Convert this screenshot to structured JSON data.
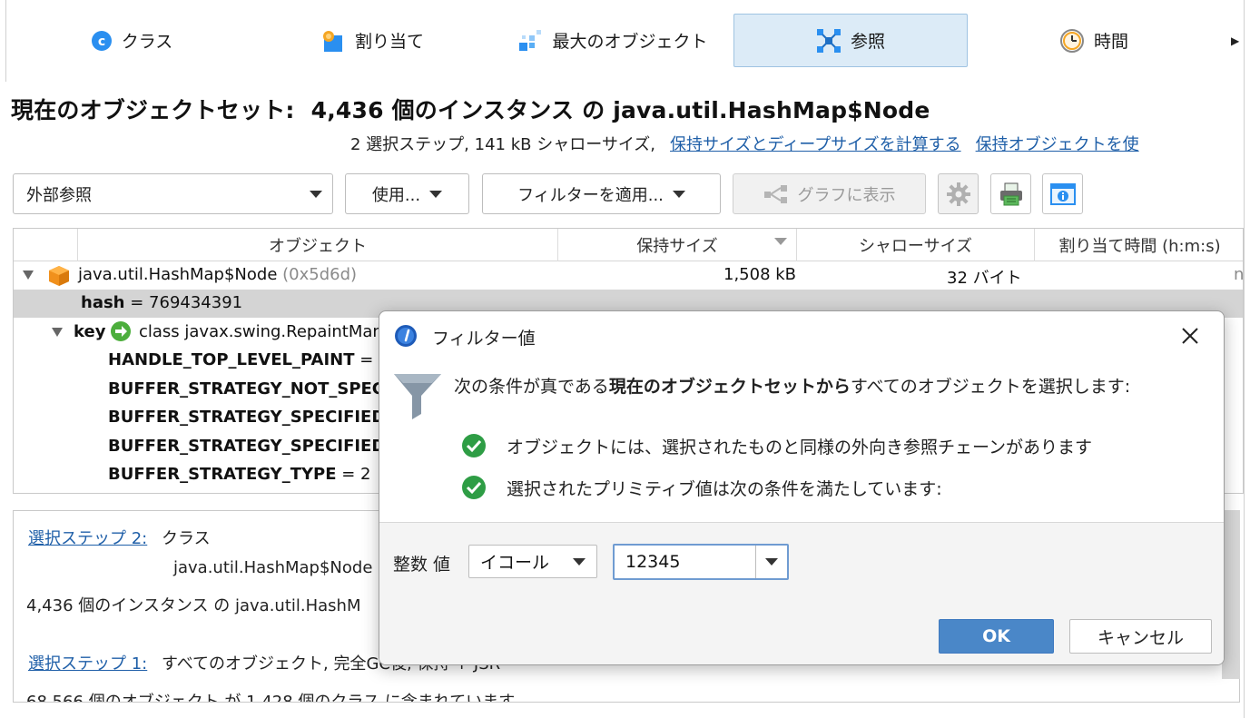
{
  "tabs": [
    {
      "label": "クラス",
      "icon": "class-icon"
    },
    {
      "label": "割り当て",
      "icon": "allocation-icon"
    },
    {
      "label": "最大のオブジェクト",
      "icon": "biggest-objects-icon"
    },
    {
      "label": "参照",
      "icon": "references-icon",
      "active": true
    },
    {
      "label": "時間",
      "icon": "clock-icon"
    }
  ],
  "header": {
    "title_prefix": "現在のオブジェクトセット:",
    "title_count": "4,436 個のインスタンス の java.util.HashMap$Node",
    "steps_info": "2 選択ステップ, 141 kB シャローサイズ,",
    "link_calc": "保持サイズとディープサイズを計算する",
    "link_retained": "保持オブジェクトを使"
  },
  "toolbar": {
    "view_select": "外部参照",
    "use_label": "使用...",
    "filter_label": "フィルターを適用...",
    "graph_label": "グラフに表示"
  },
  "table": {
    "columns": [
      "オブジェクト",
      "保持サイズ",
      "シャローサイズ",
      "割り当て時間 (h:m:s)"
    ],
    "root": {
      "name": "java.util.HashMap$Node",
      "id": "(0x5d6d)",
      "retained": "1,508 kB",
      "shallow": "32 バイト",
      "alloc": "n"
    },
    "hash": {
      "field": "hash",
      "value": "= 769434391"
    },
    "key": {
      "field": "key",
      "value": "class javax.swing.RepaintMan"
    },
    "fields": [
      {
        "name": "HANDLE_TOP_LEVEL_PAINT",
        "value": "="
      },
      {
        "name": "BUFFER_STRATEGY_NOT_SPEC",
        "value": ""
      },
      {
        "name": "BUFFER_STRATEGY_SPECIFIED",
        "value": ""
      },
      {
        "name": "BUFFER_STRATEGY_SPECIFIED",
        "value": ""
      },
      {
        "name": "BUFFER_STRATEGY_TYPE",
        "value": "= 2"
      }
    ]
  },
  "lower": {
    "step2_link": "選択ステップ 2:",
    "step2_kind": "クラス",
    "step2_class": "java.util.HashMap$Node",
    "instances": "4,436 個のインスタンス の java.util.HashM",
    "step1_link": "選択ステップ 1:",
    "step1_text": "すべてのオブジェクト, 完全GC後, 保持 + JSR",
    "objects_line": "68,566 個のオブジェクト が 1,428 個のクラス に含まれています"
  },
  "dialog": {
    "title": "フィルター値",
    "desc_pre": "次の条件が真である",
    "desc_bold": "現在のオブジェクトセットから",
    "desc_post": "すべてのオブジェクトを選択します:",
    "cond1": "オブジェクトには、選択されたものと同様の外向き参照チェーンがあります",
    "cond2": "選択されたプリミティブ値は次の条件を満たしています:",
    "int_label": "整数 値",
    "operator": "イコール",
    "value": "12345",
    "ok": "OK",
    "cancel": "キャンセル"
  },
  "colors": {
    "active_tab": "#dcebf7",
    "link": "#1f5fa8",
    "ok_button": "#4a87c8",
    "check_green": "#2e9d45"
  }
}
